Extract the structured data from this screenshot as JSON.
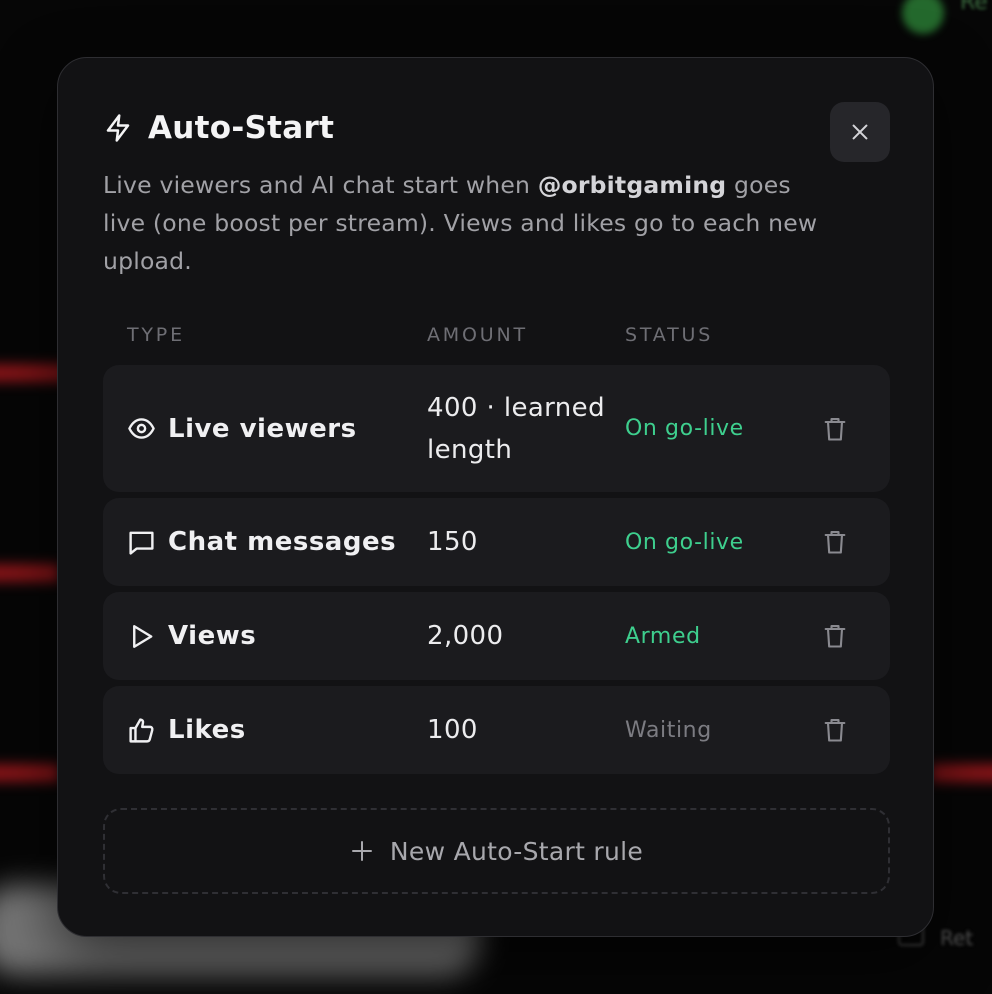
{
  "background": {
    "top_right_text": "Re",
    "bottom_left_text": "i",
    "bottom_right_text": "Ret"
  },
  "modal": {
    "title": "Auto-Start",
    "title_icon": "bolt-icon",
    "close_icon": "close-icon",
    "description_prefix": "Live viewers and AI chat start when ",
    "handle": "@orbitgaming",
    "description_suffix": " goes live (one boost per stream). Views and likes go to each new upload.",
    "columns": {
      "type": "TYPE",
      "amount": "AMOUNT",
      "status": "STATUS"
    },
    "rules": [
      {
        "icon": "eye-icon",
        "type": "Live viewers",
        "amount": "400 · learned length",
        "status": "On go-live",
        "status_color": "#3ecf8e"
      },
      {
        "icon": "chat-icon",
        "type": "Chat messages",
        "amount": "150",
        "status": "On go-live",
        "status_color": "#3ecf8e"
      },
      {
        "icon": "play-icon",
        "type": "Views",
        "amount": "2,000",
        "status": "Armed",
        "status_color": "#3ecf8e"
      },
      {
        "icon": "thumbs-up-icon",
        "type": "Likes",
        "amount": "100",
        "status": "Waiting",
        "status_color": "#7c7c82"
      }
    ],
    "new_rule_label": "New Auto-Start rule",
    "new_rule_icon": "plus-icon"
  },
  "colors": {
    "modal_bg": "#121214",
    "row_bg": "#1b1b1e",
    "accent_green": "#3ecf8e",
    "muted": "#7c7c82"
  }
}
